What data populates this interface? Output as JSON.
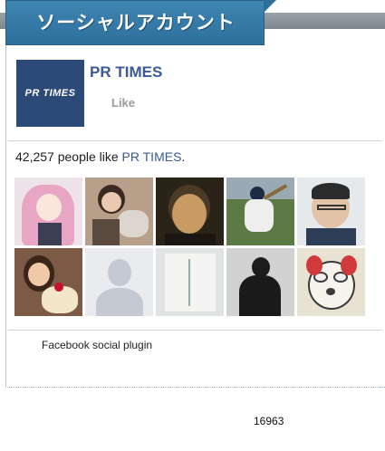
{
  "header": {
    "title": "ソーシャルアカウント"
  },
  "page": {
    "logo_text": "PR TIMES",
    "name": "PR TIMES",
    "like_label": "Like"
  },
  "fans": {
    "count_text": "42,257 people like ",
    "page_link": "PR TIMES",
    "period": "."
  },
  "faces": [
    "fan-photo-anime-girl",
    "fan-photo-woman-with-dog",
    "fan-photo-young-man",
    "fan-photo-baseball-player",
    "fan-photo-man-with-glasses",
    "fan-photo-woman-with-dessert",
    "fan-photo-default-silhouette",
    "fan-photo-name-card",
    "fan-photo-dark-portrait",
    "fan-photo-cartoon-dog"
  ],
  "colors": {
    "header": "#2e6f9c",
    "link": "#3b5998",
    "logo_bg": "#2c4a78"
  },
  "plugin": {
    "label": "Facebook social plugin"
  },
  "footer": {
    "count": "16963"
  }
}
